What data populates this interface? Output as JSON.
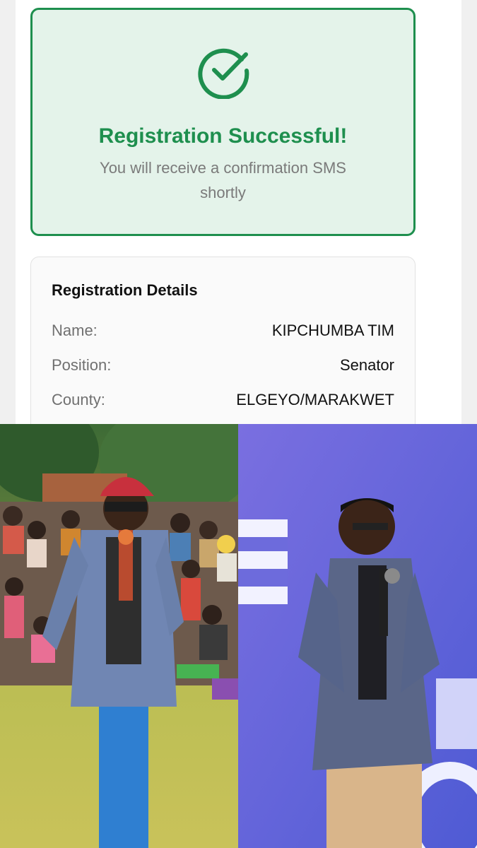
{
  "success": {
    "title": "Registration Successful!",
    "message": "You will receive a confirmation SMS shortly",
    "icon": "check-circle-icon",
    "accent_color": "#1e8f4e",
    "background_color": "#e4f3ea"
  },
  "details": {
    "title": "Registration Details",
    "rows": [
      {
        "label": "Name:",
        "value": "KIPCHUMBA TIM"
      },
      {
        "label": "Position:",
        "value": "Senator"
      },
      {
        "label": "County:",
        "value": "ELGEYO/MARAKWET"
      }
    ]
  }
}
